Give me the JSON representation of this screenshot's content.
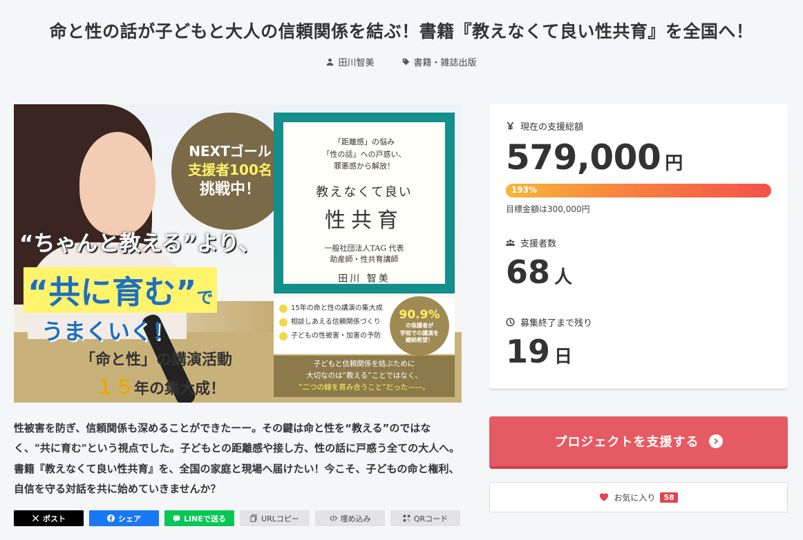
{
  "project": {
    "title": "命と性の話が子どもと大人の信頼関係を結ぶ！書籍『教えなくて良い性共育』を全国へ！",
    "author": "田川智美",
    "category": "書籍・雑誌出版",
    "description": "性被害を防ぎ、信頼関係も深めることができたーー。その鍵は命と性を“教える”のではなく、\"共に育む\"という視点でした。子どもとの距離感や接し方、性の話に戸惑う全ての大人へ。書籍『教えなくて良い性共育』を、全国の家庭と現場へ届けたい！今こそ、子どもの命と権利、自信を守る対話を共に始めていきませんか？"
  },
  "hero": {
    "circle_line1": "NEXTゴール",
    "circle_line2": "支援者100名",
    "circle_line3": "挑戦中！",
    "book_sub": "「距離感」の悩み\n「性の話」への戸惑い、\n罪悪感から解放！",
    "book_title1": "教えなくて良い",
    "book_title2": "性共育",
    "book_author_info": "一般社団法人TAG 代表\n助産師・性共育講師",
    "book_author_name": "田川 智美",
    "phrase1": "“ちゃんと教える”より、",
    "phrase2": "“共に育む”",
    "phrase2_suffix": "で",
    "phrase3": "うまくいく！",
    "phrase4": "「命と性」の講演活動",
    "phrase5_num": "１５",
    "phrase5_rest": "年の集大成！",
    "checks": [
      "15年の命と性の講演の集大成",
      "相談しあえる信頼関係づくり",
      "子どもの性被害・加害の予防"
    ],
    "badge_pct": "90.9%",
    "badge_text": "の保護者が\n学校での講演を\n継続希望！",
    "quote_line1": "子どもと信頼関係を結ぶために",
    "quote_line2": "大切なのは“教える”ことではなく、",
    "quote_line3": "“二つの線を育み合うこと”だった——。"
  },
  "share": {
    "x": "ポスト",
    "facebook": "シェア",
    "line": "LINEで送る",
    "url": "URLコピー",
    "embed": "埋め込み",
    "qr": "QRコード"
  },
  "stats": {
    "amount_label": "現在の支援総額",
    "amount": "579,000",
    "amount_unit": "円",
    "progress_text": "193%",
    "progress_percent": 193,
    "goal_text": "目標金額は300,000円",
    "backers_label": "支援者数",
    "backers": "68",
    "backers_unit": "人",
    "remaining_label": "募集終了まで残り",
    "remaining": "19",
    "remaining_unit": "日"
  },
  "actions": {
    "support_label": "プロジェクトを支援する",
    "favorite_label": "お気に入り",
    "favorite_count": "58"
  },
  "colors": {
    "support_button": "#e55a63",
    "favorite_badge": "#e0454f",
    "x_brand": "#000000",
    "facebook_brand": "#1877f2",
    "line_brand": "#06c755"
  }
}
